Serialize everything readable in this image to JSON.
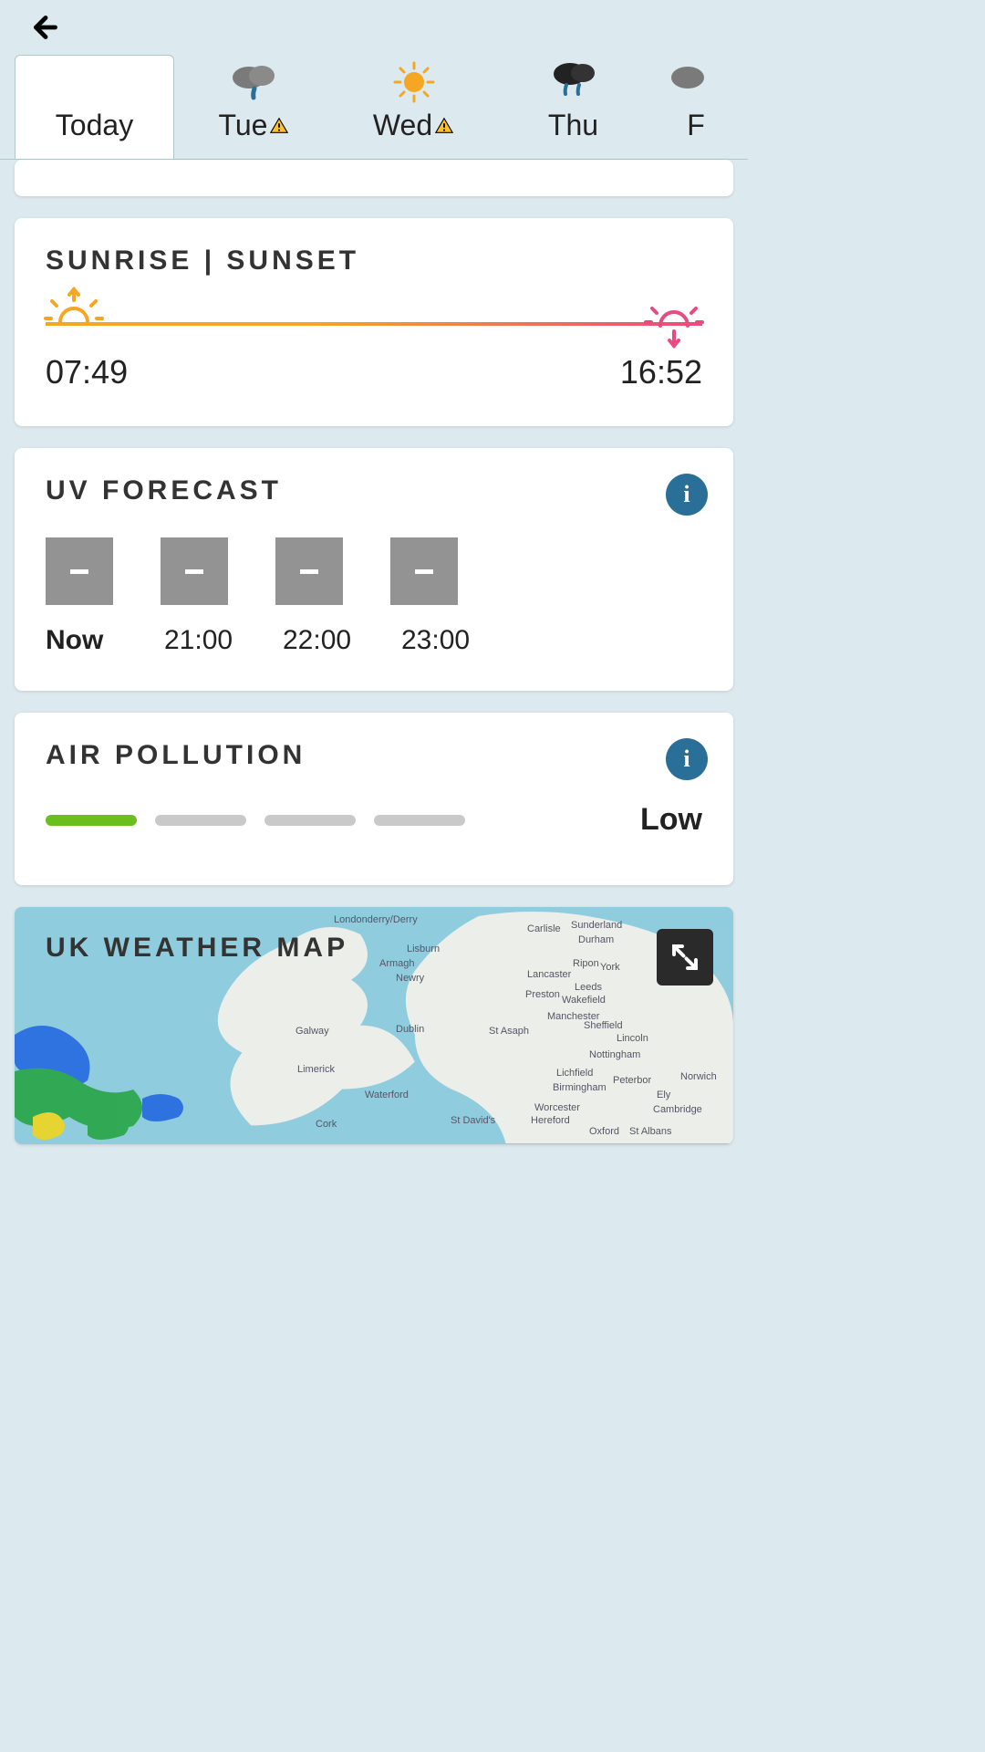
{
  "header": {
    "back_aria": "Back"
  },
  "tabs": [
    {
      "label": "Today",
      "icon": "none",
      "warning": false,
      "active": true
    },
    {
      "label": "Tue",
      "icon": "rain-cloud",
      "warning": true,
      "active": false
    },
    {
      "label": "Wed",
      "icon": "sun",
      "warning": true,
      "active": false
    },
    {
      "label": "Thu",
      "icon": "storm-cloud",
      "warning": false,
      "active": false
    },
    {
      "label": "F",
      "icon": "rain-cloud",
      "warning": false,
      "active": false
    }
  ],
  "sun": {
    "title": "SUNRISE | SUNSET",
    "sunrise": "07:49",
    "sunset": "16:52"
  },
  "uv": {
    "title": "UV FORECAST",
    "items": [
      {
        "value": "-",
        "time": "Now",
        "bold": true
      },
      {
        "value": "-",
        "time": "21:00",
        "bold": false
      },
      {
        "value": "-",
        "time": "22:00",
        "bold": false
      },
      {
        "value": "-",
        "time": "23:00",
        "bold": false
      }
    ]
  },
  "air": {
    "title": "AIR POLLUTION",
    "bars": [
      true,
      false,
      false,
      false
    ],
    "level": "Low"
  },
  "map": {
    "title": "UK WEATHER MAP",
    "labels": [
      "Londonderry/Derry",
      "Lisburn",
      "Armagh",
      "Newry",
      "Galway",
      "Limerick",
      "Waterford",
      "Cork",
      "Dublin",
      "Carlisle",
      "Sunderland",
      "Durham",
      "Ripon",
      "York",
      "Lancaster",
      "Preston",
      "Leeds",
      "Wakefield",
      "Manchester",
      "Sheffield",
      "St Asaph",
      "Lincoln",
      "Nottingham",
      "Lichfield",
      "Birmingham",
      "Peterbor",
      "Norwich",
      "Ely",
      "Cambridge",
      "Worcester",
      "Hereford",
      "St David's",
      "Oxford",
      "St Albans"
    ]
  }
}
